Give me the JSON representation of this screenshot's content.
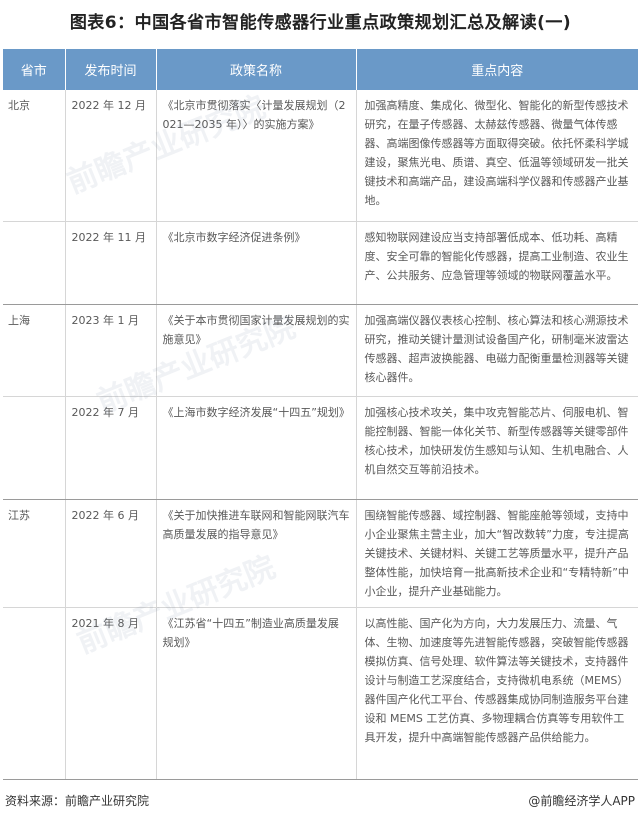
{
  "title": "图表6：中国各省市智能传感器行业重点政策规划汇总及解读(一)",
  "headers": [
    "省市",
    "发布时间",
    "政策名称",
    "重点内容"
  ],
  "rows": [
    {
      "province": "北京",
      "date": "2022 年 12 月",
      "policy": "《北京市贯彻落实〈计量发展规划（2021—2035 年）〉的实施方案》",
      "content": "加强高精度、集成化、微型化、智能化的新型传感技术研究，在量子传感器、太赫兹传感器、微量气体传感器、高端图像传感器等方面取得突破。依托怀柔科学城建设，聚焦光电、质谱、真空、低温等领域研发一批关键技术和高端产品，建设高端科学仪器和传感器产业基地。"
    },
    {
      "province": "",
      "date": "2022 年 11 月",
      "policy": "《北京市数字经济促进条例》",
      "content": "感知物联网建设应当支持部署低成本、低功耗、高精度、安全可靠的智能化传感器，提高工业制造、农业生产、公共服务、应急管理等领域的物联网覆盖水平。"
    },
    {
      "province": "上海",
      "date": "2023 年 1 月",
      "policy": "《关于本市贯彻国家计量发展规划的实施意见》",
      "content": "加强高端仪器仪表核心控制、核心算法和核心溯源技术研究，推动关键计量测试设备国产化，研制毫米波雷达传感器、超声波换能器、电磁力配衡重量检测器等关键核心器件。"
    },
    {
      "province": "",
      "date": "2022 年 7 月",
      "policy": "《上海市数字经济发展“十四五”规划》",
      "content": "加强核心技术攻关，集中攻克智能芯片、伺服电机、智能控制器、智能一体化关节、新型传感器等关键零部件核心技术，加快研发仿生感知与认知、生机电融合、人机自然交互等前沿技术。"
    },
    {
      "province": "江苏",
      "date": "2022 年 6 月",
      "policy": "《关于加快推进车联网和智能网联汽车高质量发展的指导意见》",
      "content": "围绕智能传感器、域控制器、智能座舱等领域，支持中小企业聚焦主营主业，加大“智改数转”力度，专注提高关键技术、关键材料、关键工艺等质量水平，提升产品整体性能，加快培育一批高新技术企业和“专精特新”中小企业，提升产业基础能力。"
    },
    {
      "province": "",
      "date": "2021 年 8 月",
      "policy": "《江苏省“十四五”制造业高质量发展规划》",
      "content": "以高性能、国产化为方向，大力发展压力、流量、气体、生物、加速度等先进智能传感器，突破智能传感器模拟仿真、信号处理、软件算法等关键技术，支持器件设计与制造工艺深度结合，支持微机电系统（MEMS）器件国产化代工平台、传感器集成协同制造服务平台建设和 MEMS 工艺仿真、多物理耦合仿真等专用软件工具开发，提升中高端智能传感器产品供给能力。"
    }
  ],
  "watermark_text": "前瞻产业研究院",
  "source": "资料来源：前瞻产业研究院",
  "brand": "@前瞻经济学人APP",
  "colors": {
    "header_bg": "#6a99c8",
    "header_text": "#ffffff",
    "body_text": "#595959",
    "title_text": "#222222"
  }
}
